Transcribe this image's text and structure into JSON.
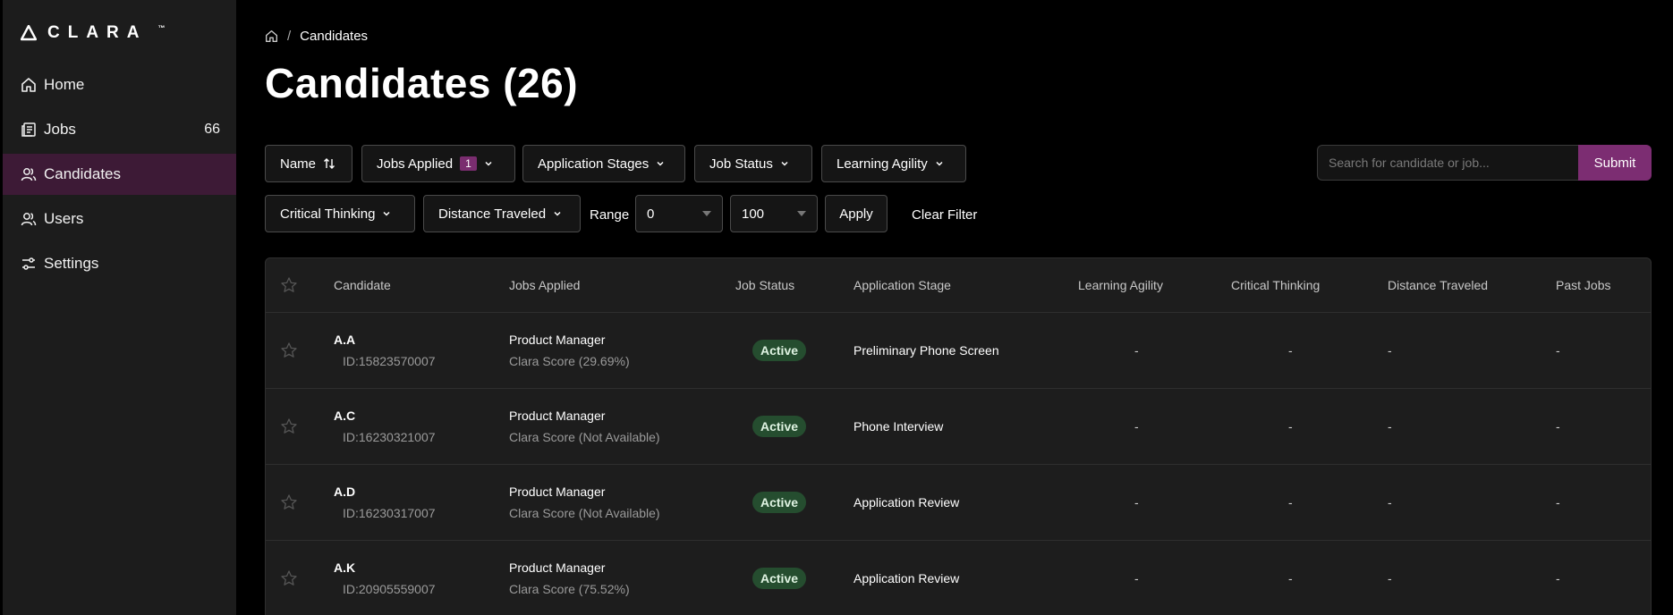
{
  "app": {
    "logo_text": "CLARA",
    "logo_tm": "™"
  },
  "sidebar": {
    "items": [
      {
        "label": "Home",
        "icon": "home-icon"
      },
      {
        "label": "Jobs",
        "icon": "jobs-icon",
        "count": "66"
      },
      {
        "label": "Candidates",
        "icon": "users-icon",
        "active": true
      },
      {
        "label": "Users",
        "icon": "users-icon"
      },
      {
        "label": "Settings",
        "icon": "settings-icon"
      }
    ]
  },
  "breadcrumb": {
    "sep": "/",
    "current": "Candidates"
  },
  "page": {
    "title": "Candidates (26)"
  },
  "filters": {
    "name": "Name",
    "jobs_applied": "Jobs Applied",
    "jobs_applied_count": "1",
    "application_stages": "Application Stages",
    "job_status": "Job Status",
    "learning_agility": "Learning Agility",
    "critical_thinking": "Critical Thinking",
    "distance_traveled": "Distance Traveled",
    "range_label": "Range",
    "range_min": "0",
    "range_max": "100",
    "apply": "Apply",
    "clear": "Clear Filter"
  },
  "search": {
    "placeholder": "Search for candidate or job...",
    "submit": "Submit"
  },
  "table": {
    "headers": {
      "candidate": "Candidate",
      "jobs_applied": "Jobs Applied",
      "job_status": "Job Status",
      "application_stage": "Application Stage",
      "learning_agility": "Learning Agility",
      "critical_thinking": "Critical Thinking",
      "distance_traveled": "Distance Traveled",
      "past_jobs": "Past Jobs"
    },
    "rows": [
      {
        "name": "A.A",
        "id": "ID:15823570007",
        "job": "Product Manager",
        "score": "Clara Score (29.69%)",
        "status": "Active",
        "stage": "Preliminary Phone Screen",
        "la": "-",
        "ct": "-",
        "dt": "-",
        "pj": "-"
      },
      {
        "name": "A.C",
        "id": "ID:16230321007",
        "job": "Product Manager",
        "score": "Clara Score (Not Available)",
        "status": "Active",
        "stage": "Phone Interview",
        "la": "-",
        "ct": "-",
        "dt": "-",
        "pj": "-"
      },
      {
        "name": "A.D",
        "id": "ID:16230317007",
        "job": "Product Manager",
        "score": "Clara Score (Not Available)",
        "status": "Active",
        "stage": "Application Review",
        "la": "-",
        "ct": "-",
        "dt": "-",
        "pj": "-"
      },
      {
        "name": "A.K",
        "id": "ID:20905559007",
        "job": "Product Manager",
        "score": "Clara Score (75.52%)",
        "status": "Active",
        "stage": "Application Review",
        "la": "-",
        "ct": "-",
        "dt": "-",
        "pj": "-"
      }
    ]
  },
  "colors": {
    "accent": "#7c2d72",
    "active_nav": "#3d1a36",
    "status_active": "#254d2f"
  }
}
